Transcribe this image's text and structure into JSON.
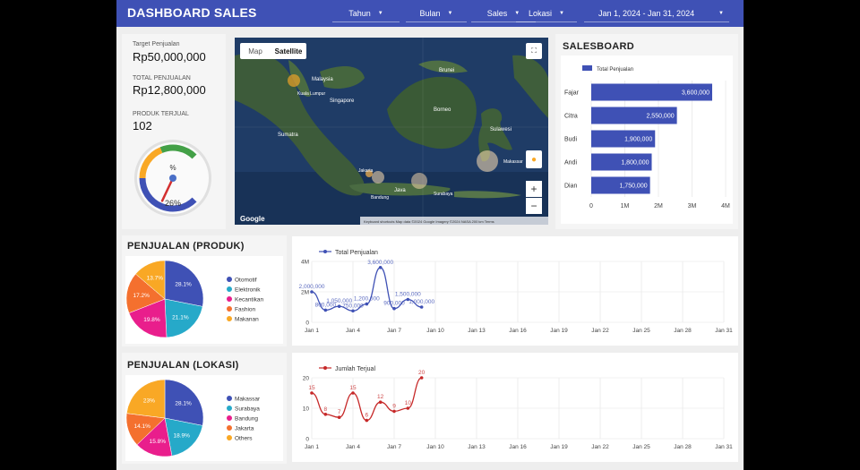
{
  "header": {
    "title": "DASHBOARD SALES",
    "filters": [
      "Tahun",
      "Bulan",
      "Sales",
      "Lokasi"
    ],
    "date_range": "Jan 1, 2024 - Jan 31, 2024"
  },
  "kpi": {
    "target_label": "Target Penjualan",
    "target_value": "Rp50,000,000",
    "total_label": "TOTAL PENJUALAN",
    "total_value": "Rp12,800,000",
    "produk_label": "PRODUK TERJUAL",
    "produk_value": "102",
    "gauge_symbol": "%",
    "gauge_value": "26%",
    "gauge_fraction": 0.26
  },
  "map": {
    "tab_map": "Map",
    "tab_satellite": "Satellite",
    "google": "Google",
    "attribution": "Keyboard shortcuts   Map data ©2024 Google Imagery ©2024 NASA   200 km   Terms",
    "labels": [
      "Malaysia",
      "Singapore",
      "Brunei",
      "Borneo",
      "Sumatra",
      "Java",
      "Sulawesi",
      "Jakarta",
      "Makassar",
      "Surabaya",
      "Bandung",
      "Kuala Lumpur"
    ],
    "zoom_in": "+",
    "zoom_out": "−"
  },
  "salesboard": {
    "title": "SALESBOARD",
    "legend": "Total Penjualan",
    "color": "#3f51b5"
  },
  "produk": {
    "title": "PENJUALAN (PRODUK)",
    "colors": [
      "#3f51b5",
      "#26a9c9",
      "#e91e8c",
      "#f4702e",
      "#f9a825"
    ]
  },
  "lokasi": {
    "title": "PENJUALAN (LOKASI)",
    "colors": [
      "#3f51b5",
      "#26a9c9",
      "#e91e8c",
      "#f4702e",
      "#f9a825"
    ]
  },
  "chart_data": [
    {
      "id": "salesboard",
      "type": "bar",
      "orientation": "horizontal",
      "categories": [
        "Fajar",
        "Citra",
        "Budi",
        "Andi",
        "Dian"
      ],
      "series": [
        {
          "name": "Total Penjualan",
          "values": [
            3600000,
            2550000,
            1900000,
            1800000,
            1750000
          ]
        }
      ],
      "data_labels": [
        "3,600,000",
        "2,550,000",
        "1,900,000",
        "1,800,000",
        "1,750,000"
      ],
      "xlim": [
        0,
        4000000
      ],
      "x_ticks": [
        "0",
        "1M",
        "2M",
        "3M",
        "4M"
      ],
      "grid": true,
      "legend": "top-left"
    },
    {
      "id": "produk",
      "type": "pie",
      "labels": [
        "Otomotif",
        "Elektronik",
        "Kecantikan",
        "Fashion",
        "Makanan"
      ],
      "values": [
        28.1,
        21.1,
        19.8,
        17.2,
        13.7
      ],
      "data_labels": [
        "28.1%",
        "21.1%",
        "19.8%",
        "17.2%",
        "13.7%"
      ],
      "legend": "right"
    },
    {
      "id": "lokasi",
      "type": "pie",
      "labels": [
        "Makassar",
        "Surabaya",
        "Bandung",
        "Jakarta",
        "Others"
      ],
      "values": [
        28.1,
        18.9,
        15.8,
        14.1,
        23
      ],
      "data_labels": [
        "28.1%",
        "18.9%",
        "15.8%",
        "14.1%",
        "23%"
      ],
      "legend": "right"
    },
    {
      "id": "penjualan_line",
      "type": "line",
      "x_ticks": [
        "Jan 1",
        "Jan 4",
        "Jan 7",
        "Jan 10",
        "Jan 13",
        "Jan 16",
        "Jan 19",
        "Jan 22",
        "Jan 25",
        "Jan 28",
        "Jan 31"
      ],
      "x": [
        1,
        2,
        3,
        4,
        5,
        6,
        7,
        8,
        9
      ],
      "series": [
        {
          "name": "Total Penjualan",
          "values": [
            2000000,
            800000,
            1050000,
            750000,
            1200000,
            3600000,
            900000,
            1500000,
            1000000
          ]
        }
      ],
      "data_labels": [
        "2,000,000",
        "800,000",
        "1,050,000",
        "750,000",
        "1,200,000",
        "3,600,000",
        "900,000",
        "1,500,000",
        "1,000,000"
      ],
      "ylim": [
        0,
        4000000
      ],
      "y_ticks": [
        "0",
        "2M",
        "4M"
      ],
      "xlim": [
        1,
        31
      ],
      "color": "#3f51b5",
      "legend": "top-left"
    },
    {
      "id": "terjual_line",
      "type": "line",
      "x_ticks": [
        "Jan 1",
        "Jan 4",
        "Jan 7",
        "Jan 10",
        "Jan 13",
        "Jan 16",
        "Jan 19",
        "Jan 22",
        "Jan 25",
        "Jan 28",
        "Jan 31"
      ],
      "x": [
        1,
        2,
        3,
        4,
        5,
        6,
        7,
        8,
        9
      ],
      "series": [
        {
          "name": "Jumlah Terjual",
          "values": [
            15,
            8,
            7,
            15,
            6,
            12,
            9,
            10,
            20
          ]
        }
      ],
      "data_labels": [
        "15",
        "8",
        "7",
        "15",
        "6",
        "12",
        "9",
        "10",
        "20"
      ],
      "ylim": [
        0,
        20
      ],
      "y_ticks": [
        "0",
        "10",
        "20"
      ],
      "xlim": [
        1,
        31
      ],
      "color": "#c62828",
      "legend": "top-left"
    }
  ]
}
